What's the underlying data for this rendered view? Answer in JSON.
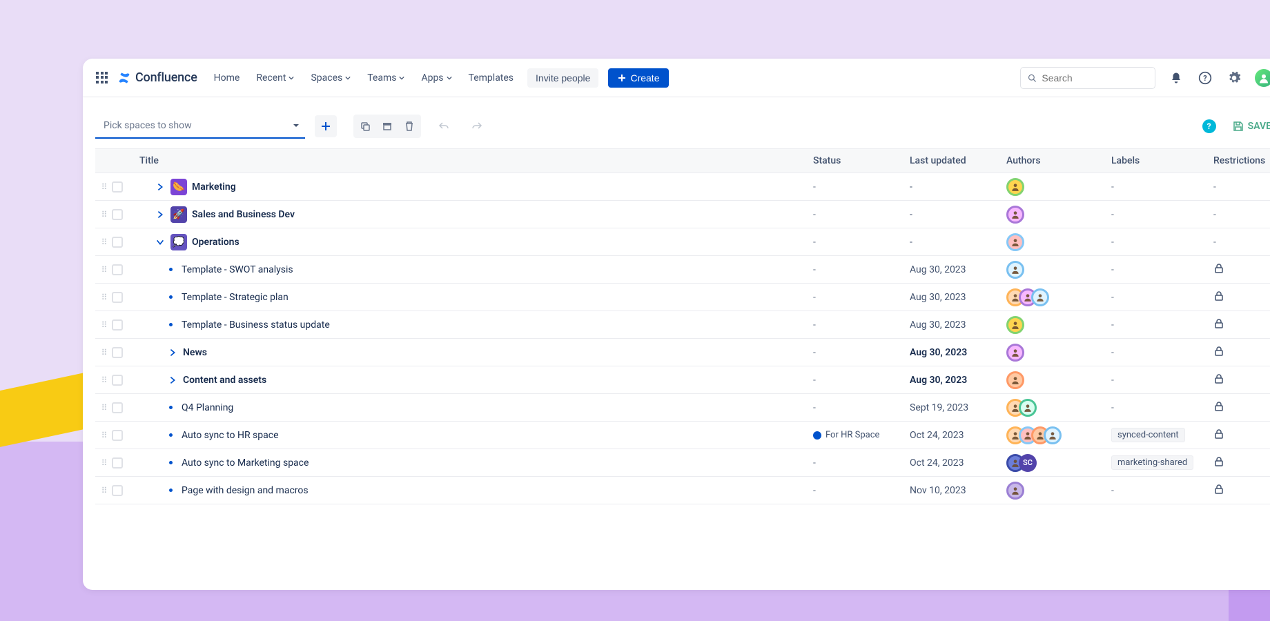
{
  "app": {
    "name": "Confluence"
  },
  "nav": {
    "home": "Home",
    "recent": "Recent",
    "spaces": "Spaces",
    "teams": "Teams",
    "apps": "Apps",
    "templates": "Templates",
    "invite": "Invite people",
    "create": "Create"
  },
  "search": {
    "placeholder": "Search"
  },
  "toolbar": {
    "picker": "Pick spaces to show",
    "save": "SAVE"
  },
  "columns": {
    "title": "Title",
    "status": "Status",
    "updated": "Last updated",
    "authors": "Authors",
    "labels": "Labels",
    "restrictions": "Restrictions"
  },
  "rows": [
    {
      "title": "Marketing",
      "kind": "space",
      "expanded": false,
      "indent": 0,
      "status": "-",
      "updated": "-",
      "authors": [
        "A"
      ],
      "labels": "-",
      "restrictions": "-",
      "iconBg": "#7b44d6",
      "iconEmoji": "🌭"
    },
    {
      "title": "Sales and Business Dev",
      "kind": "space",
      "expanded": false,
      "indent": 0,
      "status": "-",
      "updated": "-",
      "authors": [
        "B"
      ],
      "labels": "-",
      "restrictions": "-",
      "iconBg": "#5243aa",
      "iconEmoji": "🚀"
    },
    {
      "title": "Operations",
      "kind": "space",
      "expanded": true,
      "indent": 0,
      "status": "-",
      "updated": "-",
      "authors": [
        "C"
      ],
      "labels": "-",
      "restrictions": "-",
      "iconBg": "#6554c0",
      "iconEmoji": "💭"
    },
    {
      "title": "Template - SWOT analysis",
      "kind": "page",
      "indent": 1,
      "status": "-",
      "updated": "Aug 30, 2023",
      "authors": [
        "E"
      ],
      "labels": "-",
      "restrictions": "lock"
    },
    {
      "title": "Template - Strategic plan",
      "kind": "page",
      "indent": 1,
      "status": "-",
      "updated": "Aug 30, 2023",
      "authors": [
        "D",
        "B",
        "E"
      ],
      "labels": "-",
      "restrictions": "lock"
    },
    {
      "title": "Template - Business status update",
      "kind": "page",
      "indent": 1,
      "status": "-",
      "updated": "Aug 30, 2023",
      "authors": [
        "A"
      ],
      "labels": "-",
      "restrictions": "lock"
    },
    {
      "title": "News",
      "kind": "folder",
      "indent": 1,
      "status": "-",
      "updated": "Aug 30, 2023",
      "boldDate": true,
      "authors": [
        "B"
      ],
      "labels": "-",
      "restrictions": "lock"
    },
    {
      "title": "Content and assets",
      "kind": "folder",
      "indent": 1,
      "status": "-",
      "updated": "Aug 30, 2023",
      "boldDate": true,
      "authors": [
        "H"
      ],
      "labels": "-",
      "restrictions": "lock"
    },
    {
      "title": "Q4 Planning",
      "kind": "page",
      "indent": 1,
      "status": "-",
      "updated": "Sept 19, 2023",
      "authors": [
        "D",
        "F"
      ],
      "labels": "-",
      "restrictions": "lock"
    },
    {
      "title": "Auto sync to HR space",
      "kind": "page",
      "indent": 1,
      "status": "For HR Space",
      "statusDot": true,
      "updated": "Oct 24, 2023",
      "authors": [
        "D",
        "C",
        "H",
        "E"
      ],
      "labels": "synced-content",
      "restrictions": "lock"
    },
    {
      "title": "Auto sync to Marketing space",
      "kind": "page",
      "indent": 1,
      "status": "-",
      "updated": "Oct 24, 2023",
      "authors": [
        "G",
        "J"
      ],
      "labels": "marketing-shared",
      "restrictions": "lock"
    },
    {
      "title": "Page with design and macros",
      "kind": "page",
      "indent": 1,
      "status": "-",
      "updated": "Nov 10, 2023",
      "authors": [
        "I"
      ],
      "labels": "-",
      "restrictions": "lock"
    }
  ]
}
